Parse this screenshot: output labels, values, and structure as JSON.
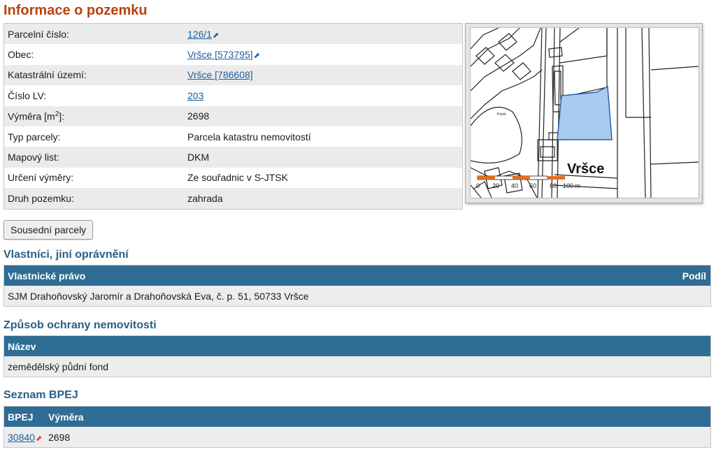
{
  "title": "Informace o pozemku",
  "info": {
    "rows": [
      {
        "label": "Parcelní číslo:",
        "value": "126/1",
        "link": true
      },
      {
        "label": "Obec:",
        "value": "Vršce [573795]",
        "link": true
      },
      {
        "label": "Katastrální území:",
        "value": "Vršce [786608]",
        "link": true
      },
      {
        "label": "Číslo LV:",
        "value": "203",
        "link": true
      },
      {
        "label_pre": "Výměra [m",
        "label_sup": "2",
        "label_post": "]:",
        "value": "2698"
      },
      {
        "label": "Typ parcely:",
        "value": "Parcela katastru nemovitostí"
      },
      {
        "label": "Mapový list:",
        "value": "DKM"
      },
      {
        "label": "Určení výměry:",
        "value": "Ze souřadnic v S-JTSK"
      },
      {
        "label": "Druh pozemku:",
        "value": "zahrada"
      }
    ]
  },
  "map": {
    "place_label": "Vršce",
    "scale_labels": [
      "0",
      "20",
      "40",
      "60",
      "80",
      "100 m"
    ],
    "parcel_color": "#a8ccf0",
    "scale_color": "#e07020"
  },
  "neighbor_button": "Sousední parcely",
  "owners": {
    "title": "Vlastníci, jiní oprávnění",
    "col_right": "Podíl",
    "col_left": "Vlastnické právo",
    "rows": [
      "SJM Drahoňovský Jaromír a Drahoňovská Eva, č. p. 51, 50733 Vršce"
    ]
  },
  "protection": {
    "title": "Způsob ochrany nemovitosti",
    "col": "Název",
    "rows": [
      "zemědělský půdní fond"
    ]
  },
  "bpej": {
    "title": "Seznam BPEJ",
    "col1": "BPEJ",
    "col2": "Výměra",
    "rows": [
      {
        "code": "30840",
        "area": "2698"
      }
    ]
  },
  "colors": {
    "title": "#b8420d",
    "section_title": "#2a5f87",
    "header_bg": "#2f6d94",
    "link": "#1b5e9e"
  }
}
